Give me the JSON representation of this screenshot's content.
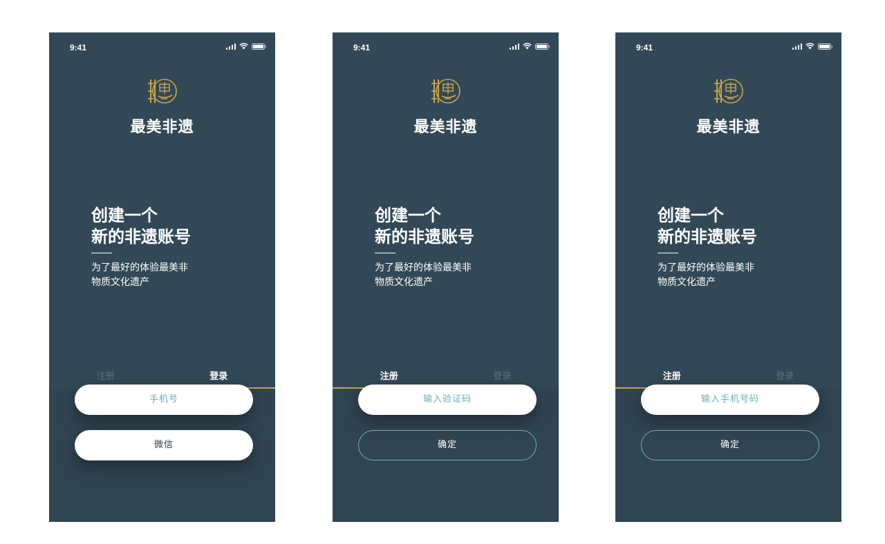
{
  "colors": {
    "background": "#324856",
    "panel": "#304452",
    "accent_gold": "#c9a64a",
    "accent_teal": "#6ab2b6",
    "text_white": "#ffffff",
    "tab_inactive": "#5b7280"
  },
  "screens": [
    {
      "status": {
        "time": "9:41"
      },
      "brand": {
        "logo_icon": "fei-yi-seal-icon",
        "name": "最美非遗"
      },
      "headline": {
        "line1": "创建一个",
        "line2": "新的非遗账号"
      },
      "subtitle": {
        "line1": "为了最好的体验最美非",
        "line2": "物质文化遗产"
      },
      "tabs": [
        {
          "label": "注册",
          "active": false
        },
        {
          "label": "登录",
          "active": true
        }
      ],
      "field": {
        "placeholder": "手机号"
      },
      "button": {
        "label": "微信"
      }
    },
    {
      "status": {
        "time": "9:41"
      },
      "brand": {
        "logo_icon": "fei-yi-seal-icon",
        "name": "最美非遗"
      },
      "headline": {
        "line1": "创建一个",
        "line2": "新的非遗账号"
      },
      "subtitle": {
        "line1": "为了最好的体验最美非",
        "line2": "物质文化遗产"
      },
      "tabs": [
        {
          "label": "注册",
          "active": true
        },
        {
          "label": "登录",
          "active": false
        }
      ],
      "field": {
        "placeholder": "输入验证码"
      },
      "button": {
        "label": "确定"
      }
    },
    {
      "status": {
        "time": "9:41"
      },
      "brand": {
        "logo_icon": "fei-yi-seal-icon",
        "name": "最美非遗"
      },
      "headline": {
        "line1": "创建一个",
        "line2": "新的非遗账号"
      },
      "subtitle": {
        "line1": "为了最好的体验最美非",
        "line2": "物质文化遗产"
      },
      "tabs": [
        {
          "label": "注册",
          "active": true
        },
        {
          "label": "登录",
          "active": false
        }
      ],
      "field": {
        "placeholder": "输入手机号码"
      },
      "button": {
        "label": "确定"
      }
    }
  ]
}
